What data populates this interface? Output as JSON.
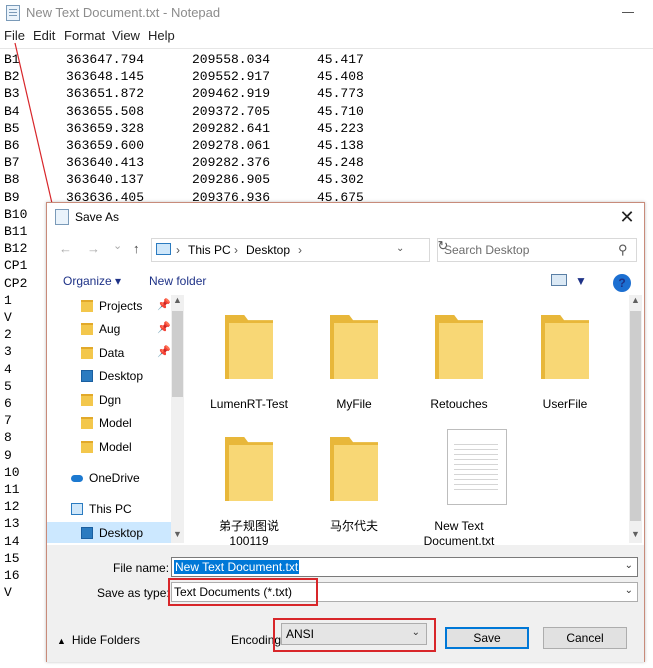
{
  "notepad": {
    "title": "New Text Document.txt - Notepad",
    "menu": [
      "File",
      "Edit",
      "Format",
      "View",
      "Help"
    ],
    "rows": [
      {
        "label": "B1",
        "x": "363647.794",
        "y": "209558.034",
        "z": "45.417"
      },
      {
        "label": "B2",
        "x": "363648.145",
        "y": "209552.917",
        "z": "45.408"
      },
      {
        "label": "B3",
        "x": "363651.872",
        "y": "209462.919",
        "z": "45.773"
      },
      {
        "label": "B4",
        "x": "363655.508",
        "y": "209372.705",
        "z": "45.710"
      },
      {
        "label": "B5",
        "x": "363659.328",
        "y": "209282.641",
        "z": "45.223"
      },
      {
        "label": "B6",
        "x": "363659.600",
        "y": "209278.061",
        "z": "45.138"
      },
      {
        "label": "B7",
        "x": "363640.413",
        "y": "209282.376",
        "z": "45.248"
      },
      {
        "label": "B8",
        "x": "363640.137",
        "y": "209286.905",
        "z": "45.302"
      },
      {
        "label": "B9",
        "x": "363636.405",
        "y": "209376.936",
        "z": "45.675"
      },
      {
        "label": "B10",
        "x": "",
        "y": "",
        "z": ""
      },
      {
        "label": "B11",
        "x": "",
        "y": "",
        "z": ""
      },
      {
        "label": "B12",
        "x": "",
        "y": "",
        "z": ""
      },
      {
        "label": "CP1",
        "x": "",
        "y": "",
        "z": ""
      },
      {
        "label": "CP2",
        "x": "",
        "y": "",
        "z": ""
      },
      {
        "label": "1",
        "x": "",
        "y": "",
        "z": ""
      },
      {
        "label": "V",
        "x": "",
        "y": "",
        "z": ""
      },
      {
        "label": "2",
        "x": "",
        "y": "",
        "z": ""
      },
      {
        "label": "3",
        "x": "",
        "y": "",
        "z": ""
      },
      {
        "label": "4",
        "x": "",
        "y": "",
        "z": ""
      },
      {
        "label": "5",
        "x": "",
        "y": "",
        "z": ""
      },
      {
        "label": "6",
        "x": "",
        "y": "",
        "z": ""
      },
      {
        "label": "7",
        "x": "",
        "y": "",
        "z": ""
      },
      {
        "label": "8",
        "x": "",
        "y": "",
        "z": ""
      },
      {
        "label": "9",
        "x": "",
        "y": "",
        "z": ""
      },
      {
        "label": "10",
        "x": "",
        "y": "",
        "z": ""
      },
      {
        "label": "11",
        "x": "",
        "y": "",
        "z": ""
      },
      {
        "label": "12",
        "x": "",
        "y": "",
        "z": ""
      },
      {
        "label": "13",
        "x": "",
        "y": "",
        "z": ""
      },
      {
        "label": "14",
        "x": "",
        "y": "",
        "z": ""
      },
      {
        "label": "15",
        "x": "",
        "y": "",
        "z": ""
      },
      {
        "label": "16",
        "x": "",
        "y": "",
        "z": ""
      },
      {
        "label": "V",
        "x": "",
        "y": "",
        "z": ""
      }
    ]
  },
  "dialog": {
    "title": "Save As",
    "close_glyph": "✕",
    "nav": {
      "back": "←",
      "forward": "→",
      "dropdown": "⌄",
      "up": "↑"
    },
    "breadcrumb": [
      "This PC",
      "Desktop"
    ],
    "breadcrumb_sep": "›",
    "refresh_glyph": "↻",
    "search_placeholder": "Search Desktop",
    "search_glyph": "⚲",
    "toolbar": {
      "organize": "Organize ▾",
      "new_folder": "New folder",
      "help": "?"
    },
    "nav_items": [
      {
        "label": "Projects",
        "icon": "folder-icon",
        "pinned": true
      },
      {
        "label": "Aug",
        "icon": "folder-icon",
        "pinned": true
      },
      {
        "label": "Data",
        "icon": "folder-icon",
        "pinned": true
      },
      {
        "label": "Desktop",
        "icon": "desktop-icon",
        "pinned": false
      },
      {
        "label": "Dgn",
        "icon": "folder-icon",
        "pinned": false
      },
      {
        "label": "Model",
        "icon": "folder-icon",
        "pinned": false
      },
      {
        "label": "Model",
        "icon": "folder-icon",
        "pinned": false
      },
      {
        "label": "OneDrive",
        "icon": "cloud-icon",
        "pinned": false
      },
      {
        "label": "This PC",
        "icon": "computer-icon",
        "pinned": false
      },
      {
        "label": "Desktop",
        "icon": "desktop-icon",
        "pinned": false,
        "selected": true
      }
    ],
    "pin_glyph": "📌",
    "files": [
      {
        "name": "LumenRT-Test",
        "type": "folder"
      },
      {
        "name": "MyFile",
        "type": "folder"
      },
      {
        "name": "Retouches",
        "type": "folder"
      },
      {
        "name": "UserFile",
        "type": "folder"
      },
      {
        "name": "弟子规图说\n100119",
        "type": "folder"
      },
      {
        "name": "马尔代夫",
        "type": "folder"
      },
      {
        "name": "New Text\nDocument.txt",
        "type": "text-document"
      }
    ],
    "file_name_label": "File name:",
    "file_name_value": "New Text Document.txt",
    "save_type_label": "Save as type:",
    "save_type_value": "Text Documents (*.txt)",
    "hide_folders": "Hide Folders",
    "hide_folders_glyph": "▲",
    "encoding_label": "Encoding:",
    "encoding_value": "ANSI",
    "save_button": "Save",
    "cancel_button": "Cancel",
    "caret_glyph": "⌄",
    "scroll_up": "▲",
    "scroll_down": "▼",
    "highlight_color": "#d8262a"
  }
}
